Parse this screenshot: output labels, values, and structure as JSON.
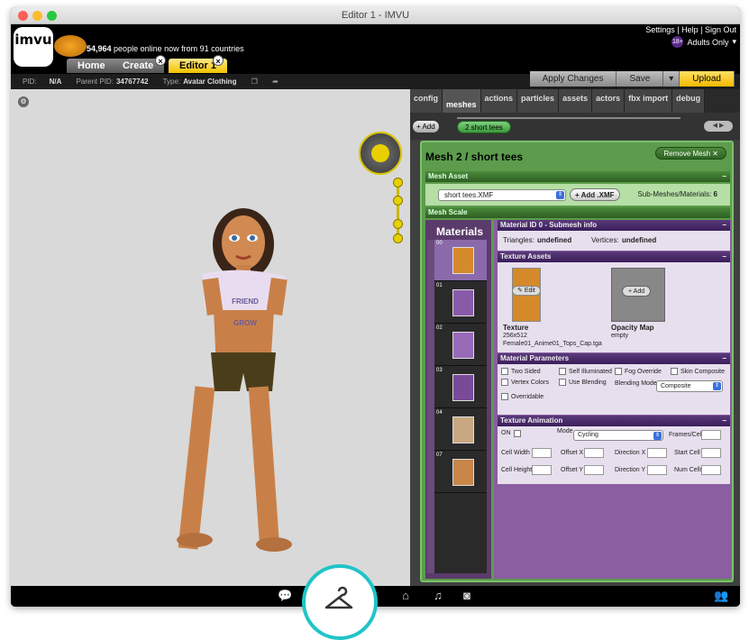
{
  "window": {
    "title": "Editor 1 - IMVU"
  },
  "header": {
    "logo_text": "imvu",
    "online_count": "54,964",
    "online_text": "people online now from 91 countries",
    "links": "Settings | Help | Sign Out",
    "age_badge": "18+",
    "adults_text": "Adults Only"
  },
  "nav": {
    "home": "Home",
    "create": "Create",
    "editor": "Editor 1"
  },
  "info": {
    "pid_label": "PID:",
    "pid": "N/A",
    "parent_label": "Parent PID:",
    "parent_pid": "34767742",
    "type_label": "Type:",
    "type": "Avatar Clothing"
  },
  "actions": {
    "apply": "Apply Changes",
    "save": "Save",
    "upload": "Upload"
  },
  "subtabs": [
    "config",
    "meshes",
    "actions",
    "particles",
    "assets",
    "actors",
    "fbx import",
    "debug"
  ],
  "meshbar": {
    "add": "Add",
    "mesh_tab": "2 short tees"
  },
  "mesh": {
    "title": "Mesh 2 / short tees",
    "remove": "Remove Mesh",
    "asset_header": "Mesh Asset",
    "selected_file": "short tees.XMF",
    "add_xmf": "Add .XMF",
    "submesh_label": "Sub-Meshes/Materials:",
    "submesh_count": "6",
    "scale_header": "Mesh Scale"
  },
  "materials": {
    "header": "Materials",
    "items": [
      {
        "num": "00"
      },
      {
        "num": "01"
      },
      {
        "num": "02"
      },
      {
        "num": "03"
      },
      {
        "num": "04"
      },
      {
        "num": "07"
      }
    ]
  },
  "matinfo": {
    "header": "Material ID 0 - Submesh info",
    "triangles_label": "Triangles:",
    "triangles": "undefined",
    "vertices_label": "Vertices:",
    "vertices": "undefined"
  },
  "texture": {
    "header": "Texture Assets",
    "edit": "Edit",
    "add": "Add",
    "texture_label": "Texture",
    "texture_size": "256x512",
    "texture_file": "Female01_Anime01_Tops_Cap.tga",
    "opacity_label": "Opacity Map",
    "opacity_value": "empty"
  },
  "params": {
    "header": "Material Parameters",
    "two_sided": "Two Sided",
    "self_illuminated": "Self Illuminated",
    "fog_override": "Fog Override",
    "skin_composite": "Skin Composite",
    "vertex_colors": "Vertex Colors",
    "use_blending": "Use Blending",
    "blending_mode": "Blending Mode",
    "blending_value": "Composite",
    "overridable": "Overridable"
  },
  "anim": {
    "header": "Texture Animation",
    "on": "ON",
    "mode": "Mode",
    "mode_value": "Cycling",
    "frames_cell": "Frames/Cell",
    "cell_width": "Cell Width",
    "offset_x": "Offset X",
    "direction_x": "Direction X",
    "start_cell": "Start Cell",
    "cell_height": "Cell Height",
    "offset_y": "Offset Y",
    "direction_y": "Direction Y",
    "num_cells": "Num Cells"
  },
  "shirt": {
    "line1": "FRIEND",
    "line2": "GROW"
  }
}
